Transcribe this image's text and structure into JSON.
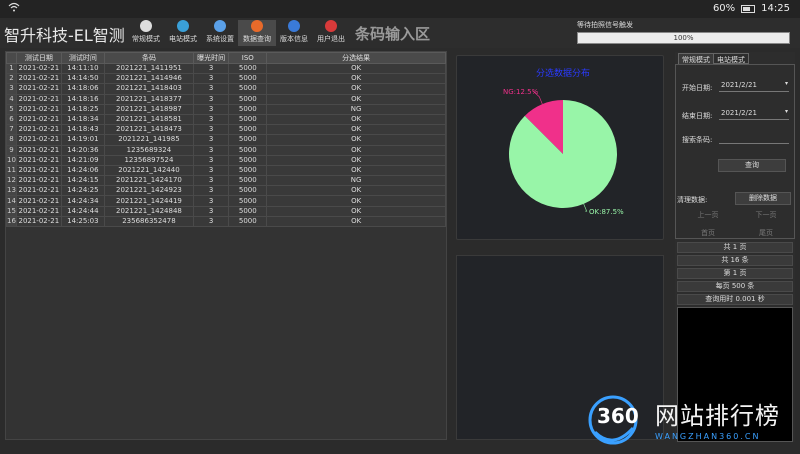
{
  "status": {
    "battery": "60%",
    "time": "14:25"
  },
  "app": {
    "title": "智升科技-EL智测",
    "zone_label": "条码输入区"
  },
  "nav": [
    {
      "label": "常规模式",
      "icon": "camera-icon",
      "color": "#dddddd"
    },
    {
      "label": "电站模式",
      "icon": "plant-icon",
      "color": "#3aa0d8"
    },
    {
      "label": "系统设置",
      "icon": "gear-icon",
      "color": "#5aa0e8"
    },
    {
      "label": "数据查询",
      "icon": "chart-icon",
      "color": "#e86a2a",
      "active": true
    },
    {
      "label": "版本信息",
      "icon": "person-icon",
      "color": "#3a7ad8"
    },
    {
      "label": "用户退出",
      "icon": "power-icon",
      "color": "#d83a3a"
    }
  ],
  "trigger": {
    "label": "等待拍照信号触发",
    "progress_text": "100%",
    "progress": 1.0
  },
  "table": {
    "headers": [
      "",
      "测试日期",
      "测试时间",
      "条码",
      "曝光时间",
      "ISO",
      "分选结果"
    ],
    "rows": [
      [
        "1",
        "2021-02-21",
        "14:11:10",
        "2021221_1411951",
        "3",
        "5000",
        "OK"
      ],
      [
        "2",
        "2021-02-21",
        "14:14:50",
        "2021221_1414946",
        "3",
        "5000",
        "OK"
      ],
      [
        "3",
        "2021-02-21",
        "14:18:06",
        "2021221_1418403",
        "3",
        "5000",
        "OK"
      ],
      [
        "4",
        "2021-02-21",
        "14:18:16",
        "2021221_1418377",
        "3",
        "5000",
        "OK"
      ],
      [
        "5",
        "2021-02-21",
        "14:18:25",
        "2021221_1418987",
        "3",
        "5000",
        "NG"
      ],
      [
        "6",
        "2021-02-21",
        "14:18:34",
        "2021221_1418581",
        "3",
        "5000",
        "OK"
      ],
      [
        "7",
        "2021-02-21",
        "14:18:43",
        "2021221_1418473",
        "3",
        "5000",
        "OK"
      ],
      [
        "8",
        "2021-02-21",
        "14:19:01",
        "2021221_141985",
        "3",
        "5000",
        "OK"
      ],
      [
        "9",
        "2021-02-21",
        "14:20:36",
        "1235689324",
        "3",
        "5000",
        "OK"
      ],
      [
        "10",
        "2021-02-21",
        "14:21:09",
        "12356897524",
        "3",
        "5000",
        "OK"
      ],
      [
        "11",
        "2021-02-21",
        "14:24:06",
        "2021221_142440",
        "3",
        "5000",
        "OK"
      ],
      [
        "12",
        "2021-02-21",
        "14:24:15",
        "2021221_1424170",
        "3",
        "5000",
        "NG"
      ],
      [
        "13",
        "2021-02-21",
        "14:24:25",
        "2021221_1424923",
        "3",
        "5000",
        "OK"
      ],
      [
        "14",
        "2021-02-21",
        "14:24:34",
        "2021221_1424419",
        "3",
        "5000",
        "OK"
      ],
      [
        "15",
        "2021-02-21",
        "14:24:44",
        "2021221_1424848",
        "3",
        "5000",
        "OK"
      ],
      [
        "16",
        "2021-02-21",
        "14:25:03",
        "235686352478",
        "3",
        "5000",
        "OK"
      ]
    ]
  },
  "chart_data": {
    "type": "pie",
    "title": "分选数据分布",
    "slices": [
      {
        "label": "OK:87.5%",
        "value": 87.5,
        "color": "#98f5a8"
      },
      {
        "label": "NG:12.5%",
        "value": 12.5,
        "color": "#f0308a"
      }
    ]
  },
  "right": {
    "tabs": [
      "常规模式",
      "电站模式"
    ],
    "start_label": "开始日期:",
    "start_value": "2021/2/21",
    "end_label": "结束日期:",
    "end_value": "2021/2/21",
    "barcode_label": "搜索条码:",
    "query_btn": "查询",
    "clear_label": "清理数据:",
    "delete_btn": "删除数据",
    "prev_btn": "上一页",
    "next_btn": "下一页",
    "first_btn": "首页",
    "last_btn": "尾页",
    "stats": [
      "共 1 页",
      "共 16 条",
      "第 1 页",
      "每页 500 条",
      "查询用时 0.001 秒"
    ]
  },
  "watermark": {
    "big": "360",
    "text": "网站排行榜",
    "url": "WANGZHAN360.CN"
  }
}
